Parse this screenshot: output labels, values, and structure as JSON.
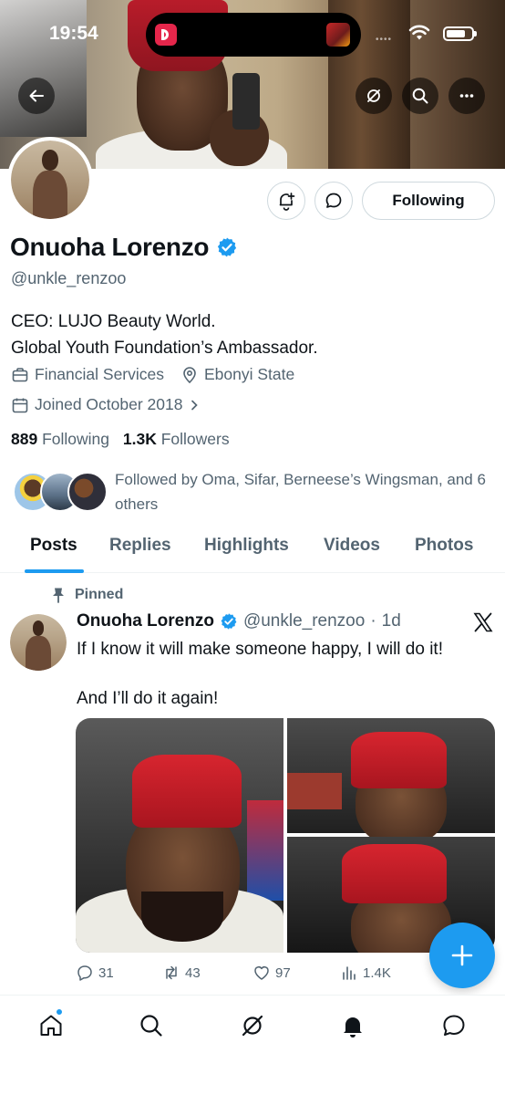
{
  "status_bar": {
    "time": "19:54"
  },
  "profile": {
    "name": "Onuoha Lorenzo",
    "handle": "@unkle_renzoo",
    "bio_line1": "CEO: LUJO Beauty World.",
    "bio_line2": "Global Youth Foundation’s Ambassador.",
    "category": "Financial Services",
    "location": "Ebonyi State",
    "joined": "Joined October 2018",
    "following_count": "889",
    "following_label": "Following",
    "followers_count": "1.3K",
    "followers_label": "Followers",
    "followed_by": "Followed by Oma, Sifar, Berneese’s Wingsman, and 6 others",
    "follow_button_label": "Following"
  },
  "tabs": [
    {
      "label": "Posts",
      "active": true
    },
    {
      "label": "Replies"
    },
    {
      "label": "Highlights"
    },
    {
      "label": "Videos"
    },
    {
      "label": "Photos"
    }
  ],
  "tweet": {
    "pinned_label": "Pinned",
    "author_name": "Onuoha Lorenzo",
    "author_handle": "@unkle_renzoo",
    "separator": "·",
    "time": "1d",
    "text": "If I know it will make someone happy, I will do it!\n\nAnd I’ll do it again!",
    "replies": "31",
    "reposts": "43",
    "likes": "97",
    "views": "1.4K"
  },
  "colors": {
    "accent": "#1d9bf0",
    "secondary_text": "#536471",
    "primary_text": "#0f1419",
    "border": "#cfd9de"
  },
  "icons": {
    "back": "arrow-left-icon",
    "grok": "grok-icon",
    "search": "search-icon",
    "more": "more-icon",
    "notify": "bell-plus-icon",
    "message": "chat-bubble-icon",
    "verified": "verified-badge-icon",
    "briefcase": "briefcase-icon",
    "location": "location-pin-icon",
    "calendar": "calendar-icon",
    "pin": "pin-icon",
    "x_logo": "x-logo-icon"
  }
}
